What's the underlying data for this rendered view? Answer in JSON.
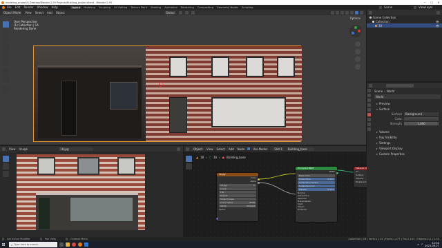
{
  "window": {
    "title": "modeling_project/X-Desktop/Blender-2.93 Projects/Building_project.blend - Blender 2.93"
  },
  "menu": {
    "items": [
      "File",
      "Edit",
      "Render",
      "Window",
      "Help"
    ],
    "workspaces": [
      "Layout",
      "Modeling",
      "Sculpting",
      "UV Editing",
      "Texture Paint",
      "Shading",
      "Animation",
      "Rendering",
      "Compositing",
      "Geometry Nodes",
      "Scripting"
    ],
    "active_workspace": "Layout",
    "scene_label": "Scene",
    "view_layer_label": "ViewLayer"
  },
  "viewport": {
    "mode": "Object Mode",
    "menus": [
      "View",
      "Select",
      "Add",
      "Object"
    ],
    "transform": "Global",
    "overlay_line1": "User Perspective",
    "overlay_line2": "(1) Collection | 1A",
    "overlay_line3": "Rendering Done",
    "options_label": "Options"
  },
  "image_editor": {
    "menus": [
      "View",
      "Image"
    ],
    "image_name": "18.jpg"
  },
  "node_editor": {
    "object_label": "Object",
    "menus": [
      "View",
      "Select",
      "Add",
      "Node"
    ],
    "use_nodes_label": "Use Nodes",
    "slot_label": "Slot 1",
    "material_name": "Building_base",
    "breadcrumb_object": "18",
    "breadcrumb_material": "18",
    "breadcrumb_name": "Building_base",
    "image_node": {
      "title": "18.jpg",
      "outputs": [
        "Color",
        "Alpha"
      ],
      "image_field": "18.jpg",
      "fields": [
        {
          "label": "Linear",
          "value": ""
        },
        {
          "label": "Flat",
          "value": ""
        },
        {
          "label": "Repeat",
          "value": ""
        },
        {
          "label": "Single Image",
          "value": ""
        },
        {
          "label": "Color Space",
          "value": "sRGB"
        },
        {
          "label": "Alpha",
          "value": "Straight"
        }
      ],
      "vector_label": "Vector"
    },
    "bsdf_node": {
      "title": "Principled BSDF",
      "output": "BSDF",
      "rows": [
        {
          "label": "Base Color",
          "value": ""
        },
        {
          "label": "Subsurface",
          "value": "0.000"
        },
        {
          "label": "Subsurface Radius",
          "value": ""
        },
        {
          "label": "Subsurface Col",
          "value": ""
        },
        {
          "label": "Metallic",
          "value": "0.000"
        }
      ],
      "extra_rows": [
        "Normal",
        "Subsurface",
        "Specular",
        "Transmission",
        "Coat",
        "Sheen",
        "Emission"
      ]
    },
    "output_node": {
      "title": "Material Output",
      "rows": [
        "All",
        "Surface",
        "Volume",
        "Displacement"
      ]
    }
  },
  "outliner": {
    "title": "Scene Collection",
    "items": [
      "Collection",
      "18"
    ]
  },
  "properties": {
    "scene_label": "Scene",
    "world_label": "World",
    "world_name": "World",
    "sections_top": [
      "Preview",
      "Surface"
    ],
    "surface_label": "Surface",
    "surface_value": "Background",
    "color_label": "Color",
    "strength_label": "Strength",
    "strength_value": "1.000",
    "sections_bottom": [
      "Volume",
      "Ray Visibility",
      "Settings",
      "Viewport Display",
      "Custom Properties"
    ]
  },
  "status_bar": {
    "left": "Set Active Modifier",
    "middle1": "Pan View",
    "middle2": "Context Menu",
    "right": "Collection | 18 | Verts:1,124 | Faces:1,077 | Tris:2,154 | Objects:1/1 | 2.93"
  },
  "taskbar": {
    "search_placeholder": "Type here to search",
    "time": "11:02",
    "date": "2021-09-27"
  },
  "colors": {
    "accent": "#4772b3",
    "selection_outline": "#e8912d",
    "image_node_header": "#8b4c16",
    "bsdf_header": "#2c8a3f",
    "output_header": "#8a2424"
  }
}
